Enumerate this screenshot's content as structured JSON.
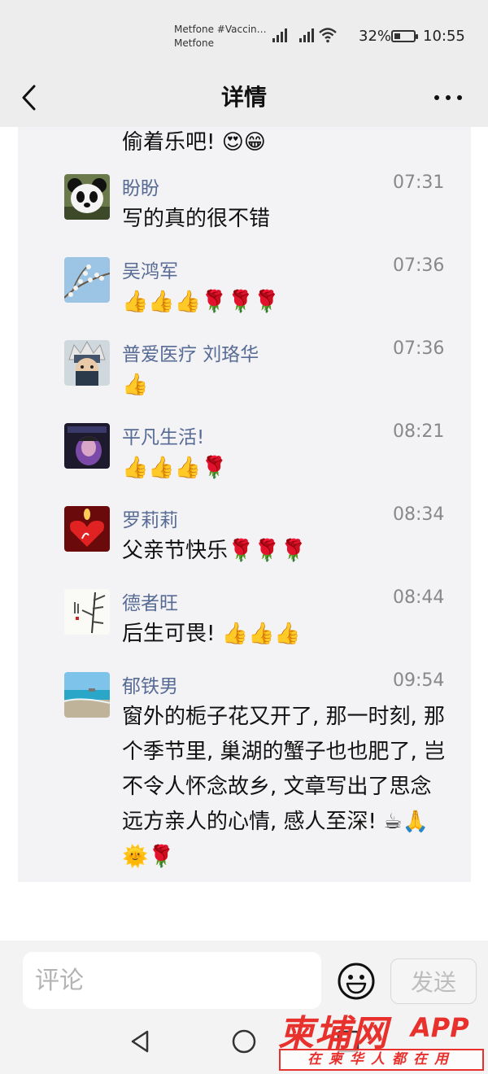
{
  "status_bar": {
    "carrier_line1": "Metfone #Vaccin…",
    "carrier_line2": "Metfone",
    "battery": "32%",
    "battery_level": 0.32,
    "time": "10:55"
  },
  "nav": {
    "title": "详情",
    "back_icon": "chevron-left-icon",
    "more_icon": "more-dots-icon"
  },
  "partial_comment": {
    "text": "偷着乐吧! 😍😁"
  },
  "comments": [
    {
      "name": "盼盼",
      "time": "07:31",
      "text": "写的真的很不错",
      "avatar": "panda"
    },
    {
      "name": "吴鸿军",
      "time": "07:36",
      "text": "👍👍👍🌹🌹🌹",
      "avatar": "blossom"
    },
    {
      "name": "普爱医疗 刘珞华",
      "time": "07:36",
      "text": "👍",
      "avatar": "anime"
    },
    {
      "name": "平凡生活!",
      "time": "08:21",
      "text": "👍👍👍🌹",
      "avatar": "dark-photo"
    },
    {
      "name": "罗莉莉",
      "time": "08:34",
      "text": "父亲节快乐🌹🌹🌹",
      "avatar": "heart"
    },
    {
      "name": "德者旺",
      "time": "08:44",
      "text": "后生可畏! 👍👍👍",
      "avatar": "ink-bamboo"
    },
    {
      "name": "郁铁男",
      "time": "09:54",
      "text": "窗外的栀子花又开了, 那一时刻, 那个季节里, 巢湖的蟹子也也肥了, 岂不令人怀念故乡, 文章写出了思念远方亲人的心情, 感人至深! ☕🙏🌞🌹",
      "avatar": "beach"
    }
  ],
  "bottom": {
    "comment_placeholder": "评论",
    "send_label": "发送",
    "emoji_icon": "smiley-icon"
  },
  "watermark": {
    "main": "柬埔网",
    "app": "APP",
    "sub": "在柬华人都在用"
  },
  "colors": {
    "name_link": "#576b95",
    "watermark_red": "#e8302d",
    "header_bg": "#ededed",
    "panel_bg": "#f3f3f5"
  }
}
